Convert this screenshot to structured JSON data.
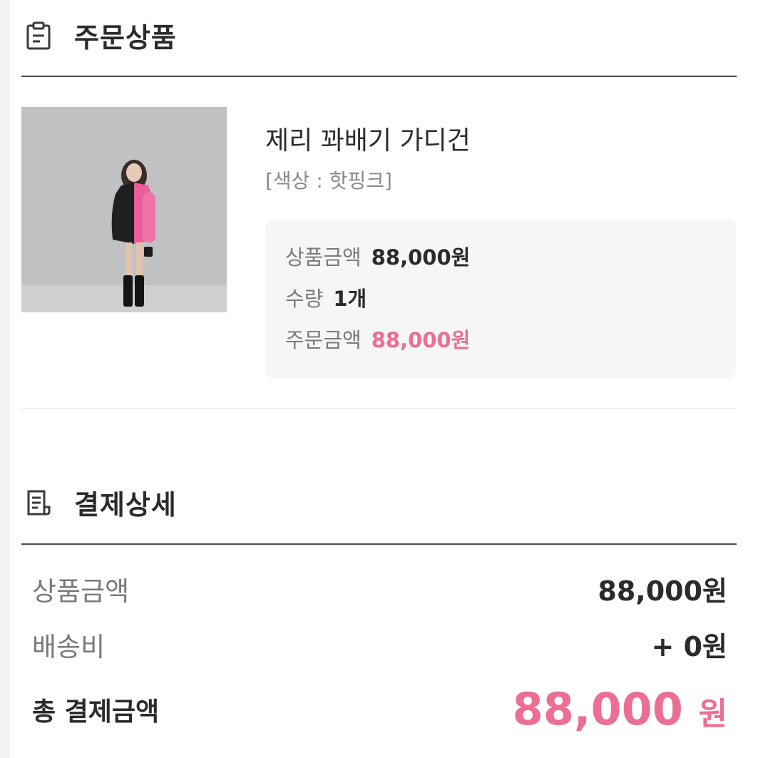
{
  "order_section": {
    "title": "주문상품",
    "icon": "clipboard-icon"
  },
  "product": {
    "image": "cardigan-photo",
    "name": "제리 꽈배기 가디건",
    "option": "[색상 : 핫핑크]",
    "price_label": "상품금액",
    "price_value": "88,000원",
    "qty_label": "수량",
    "qty_value": "1개",
    "order_label": "주문금액",
    "order_value": "88,000원"
  },
  "payment_section": {
    "title": "결제상세",
    "icon": "receipt-icon"
  },
  "payment": {
    "subtotal_label": "상품금액",
    "subtotal_value": "88,000원",
    "shipping_label": "배송비",
    "shipping_value": "+ 0원",
    "total_label": "총 결제금액",
    "total_amount": "88,000",
    "total_unit": "원"
  },
  "colors": {
    "accent_pink": "#ec6f93",
    "text_dark": "#2b2b2b",
    "text_gray": "#7a7a7a",
    "box_bg": "#f6f6f6"
  }
}
